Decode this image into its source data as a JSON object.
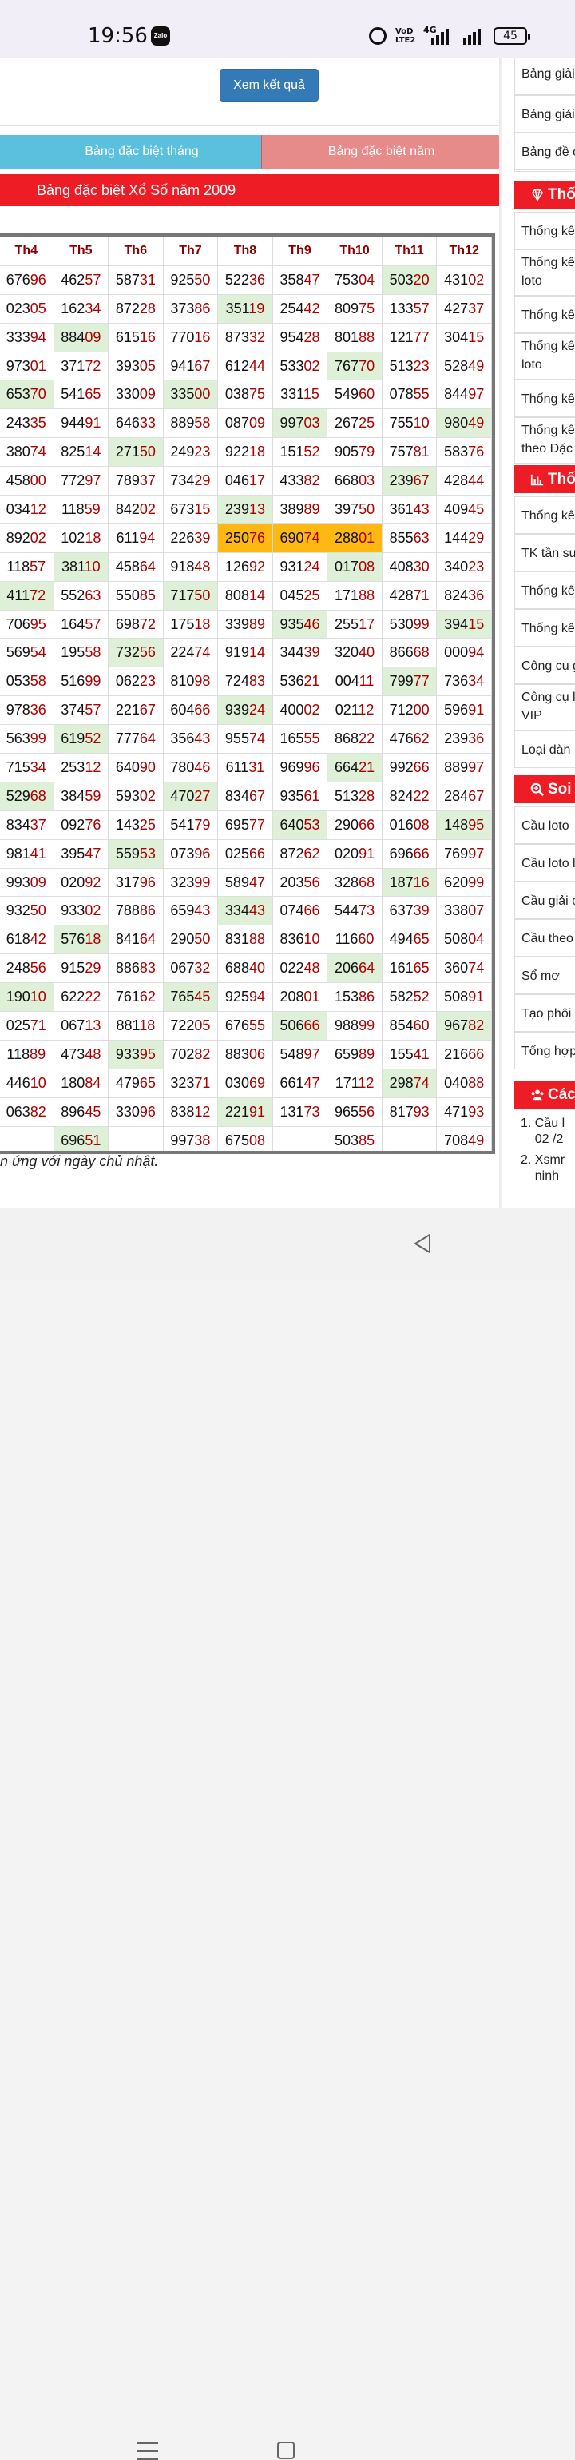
{
  "status": {
    "time": "19:56",
    "zalo": "Zalo",
    "volte": "VoD\nLTE2",
    "net": "4G",
    "battery": "45"
  },
  "form": {
    "button": "Xem kết quả"
  },
  "tabs": {
    "month": "Bảng đặc biệt tháng",
    "year": "Bảng đặc biệt năm"
  },
  "heading": "Bảng đặc biệt Xổ Số năm 2009",
  "table": {
    "headers": [
      "Th4",
      "Th5",
      "Th6",
      "Th7",
      "Th8",
      "Th9",
      "Th10",
      "Th11",
      "Th12"
    ],
    "rows": [
      [
        "67696",
        "46257",
        "58731",
        "92550",
        "52236",
        "35847",
        "75304",
        "50320",
        "43102"
      ],
      [
        "02305",
        "16234",
        "87228",
        "37386",
        "35119",
        "25442",
        "80975",
        "13357",
        "42737"
      ],
      [
        "33394",
        "88409",
        "61516",
        "77016",
        "87332",
        "95428",
        "80188",
        "12177",
        "30415"
      ],
      [
        "97301",
        "37172",
        "39305",
        "94167",
        "61244",
        "53302",
        "76770",
        "51323",
        "52849"
      ],
      [
        "65370",
        "54165",
        "33009",
        "33500",
        "03875",
        "33115",
        "54960",
        "07855",
        "84497"
      ],
      [
        "24335",
        "94491",
        "64633",
        "88958",
        "08709",
        "99703",
        "26725",
        "75510",
        "98049"
      ],
      [
        "38074",
        "82514",
        "27150",
        "24923",
        "92218",
        "15152",
        "90579",
        "75781",
        "58376"
      ],
      [
        "45800",
        "77297",
        "78937",
        "73429",
        "04617",
        "43382",
        "66803",
        "23967",
        "42844"
      ],
      [
        "03412",
        "11859",
        "84202",
        "67315",
        "23913",
        "38989",
        "39750",
        "36143",
        "40945"
      ],
      [
        "89202",
        "10218",
        "61194",
        "22639",
        "25076",
        "69074",
        "28801",
        "85563",
        "14429"
      ],
      [
        "11857",
        "38110",
        "45864",
        "91848",
        "12692",
        "93124",
        "01708",
        "40830",
        "34023"
      ],
      [
        "41172",
        "55263",
        "55085",
        "71750",
        "80814",
        "04525",
        "17188",
        "42871",
        "82436"
      ],
      [
        "70695",
        "16457",
        "69872",
        "17518",
        "33989",
        "93546",
        "25517",
        "53099",
        "39415"
      ],
      [
        "56954",
        "19558",
        "73256",
        "22474",
        "91914",
        "34439",
        "32040",
        "86668",
        "00094"
      ],
      [
        "05358",
        "51699",
        "06223",
        "81098",
        "72483",
        "53621",
        "00411",
        "79977",
        "73634"
      ],
      [
        "97836",
        "37457",
        "22167",
        "60466",
        "93924",
        "40002",
        "02112",
        "71200",
        "59691"
      ],
      [
        "56399",
        "61952",
        "77764",
        "35643",
        "95574",
        "16555",
        "86822",
        "47662",
        "23936"
      ],
      [
        "71534",
        "25312",
        "64090",
        "78046",
        "61131",
        "96996",
        "66421",
        "99266",
        "88997"
      ],
      [
        "52968",
        "38459",
        "59302",
        "47027",
        "83467",
        "93561",
        "51328",
        "82422",
        "28467"
      ],
      [
        "83437",
        "09276",
        "14325",
        "54179",
        "69577",
        "64053",
        "29066",
        "01608",
        "14895"
      ],
      [
        "98141",
        "39547",
        "55953",
        "07396",
        "02566",
        "87262",
        "02091",
        "69666",
        "76997"
      ],
      [
        "99309",
        "02092",
        "31796",
        "32399",
        "58947",
        "20356",
        "32868",
        "18716",
        "62099"
      ],
      [
        "93250",
        "93302",
        "78886",
        "65943",
        "33443",
        "07466",
        "54473",
        "63739",
        "33807"
      ],
      [
        "61842",
        "57618",
        "84164",
        "29050",
        "83188",
        "83610",
        "11660",
        "49465",
        "50804"
      ],
      [
        "24856",
        "91529",
        "88683",
        "06732",
        "68840",
        "02248",
        "20664",
        "16165",
        "36074"
      ],
      [
        "19010",
        "62222",
        "76162",
        "76545",
        "92594",
        "20801",
        "15386",
        "58252",
        "50891"
      ],
      [
        "02571",
        "06713",
        "88118",
        "72205",
        "67655",
        "50666",
        "98899",
        "85460",
        "96782"
      ],
      [
        "11889",
        "47348",
        "93395",
        "70282",
        "88306",
        "54897",
        "65989",
        "15541",
        "21666"
      ],
      [
        "44610",
        "18084",
        "47965",
        "32371",
        "03069",
        "66147",
        "17112",
        "29874",
        "04088"
      ],
      [
        "06382",
        "89645",
        "33096",
        "83812",
        "22191",
        "13173",
        "96556",
        "81793",
        "47193"
      ],
      [
        "",
        "69651",
        "",
        "99738",
        "67508",
        "",
        "50385",
        "",
        "70849"
      ]
    ]
  },
  "note": "n ứng với ngày chủ nhật.",
  "sidebar": {
    "top_items": [
      "Bảng giải",
      "Bảng giải",
      "Bảng đề c"
    ],
    "head1": "Thố",
    "group1": [
      "Thống kê",
      "Thống kê\nloto",
      "Thống kê",
      "Thống kê\nloto",
      "Thống kê",
      "Thống kê\ntheo Đặc"
    ],
    "head2": "Thố",
    "group2": [
      "Thống kê",
      "TK tần su",
      "Thống kê",
      "Thống kê",
      "Công cụ g",
      "Công cụ l\nVIP",
      "Loại dàn"
    ],
    "head3": "Soi c",
    "group3": [
      "Cầu loto",
      "Cầu loto l",
      "Cầu giải c",
      "Cầu theo",
      "Sổ mơ",
      "Tạo phôi",
      "Tổng hợp"
    ],
    "head4": "Các",
    "list": [
      "1. Cầu l\n02 /2",
      "2. Xsmr\nninh"
    ]
  }
}
